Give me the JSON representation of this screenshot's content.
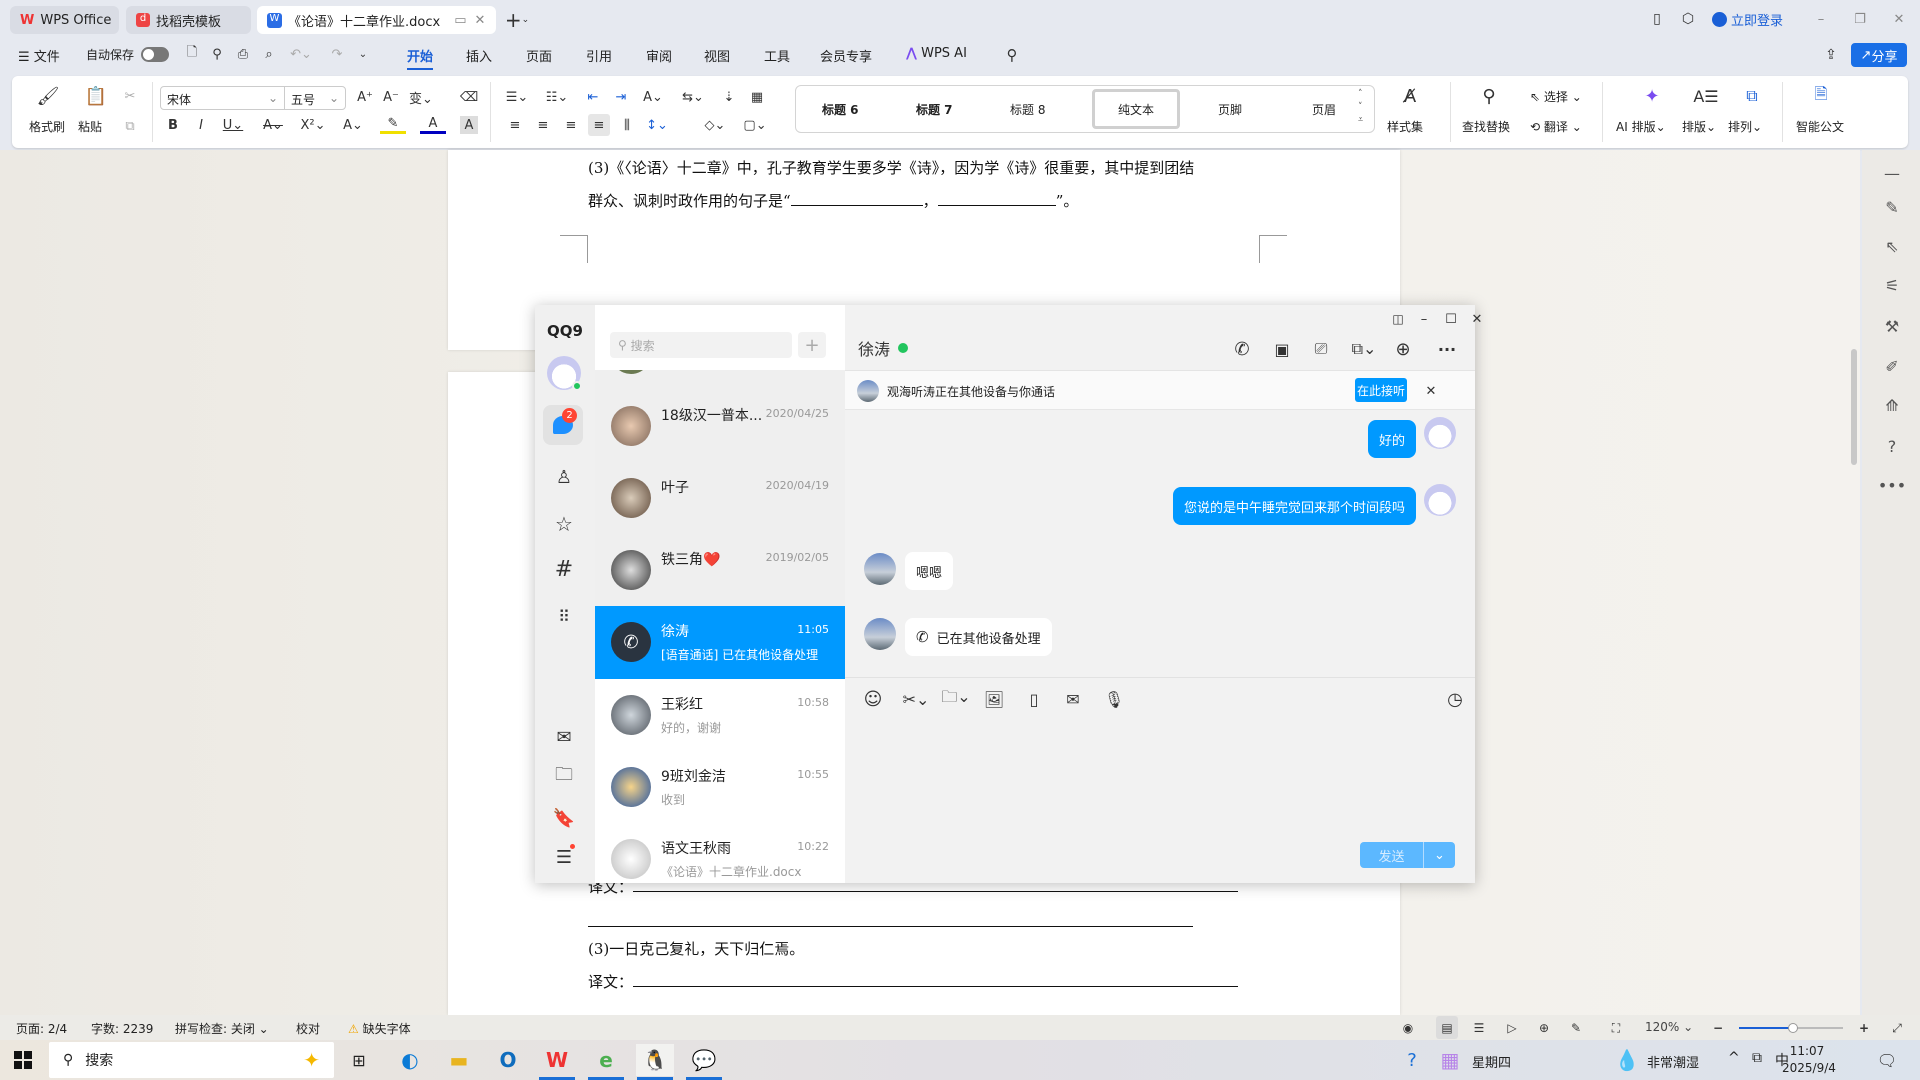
{
  "tabs": [
    {
      "label": "WPS Office"
    },
    {
      "label": "找稻壳模板"
    },
    {
      "label": "《论语》十二章作业.docx"
    }
  ],
  "titlebar": {
    "login": "立即登录"
  },
  "menu": {
    "file": "文件",
    "autosave": "自动保存",
    "items": [
      "开始",
      "插入",
      "页面",
      "引用",
      "审阅",
      "视图",
      "工具",
      "会员专享",
      "WPS AI"
    ],
    "active": "开始",
    "share": "分享"
  },
  "ribbon": {
    "format_painter": "格式刷",
    "paste": "粘贴",
    "font_name": "宋体",
    "font_size": "五号",
    "styles": [
      "标题 6",
      "标题 7",
      "标题 8",
      "纯文本",
      "页脚",
      "页眉"
    ],
    "selected_style": "纯文本",
    "style_set": "样式集",
    "find_replace": "查找替换",
    "select": "选择",
    "translate": "翻译",
    "ai_layout": "AI 排版",
    "layout": "排版",
    "arrange": "排列",
    "smart_doc": "智能公文"
  },
  "document": {
    "line1": "(3)《〈论语〉十二章》中，孔子教育学生要多学《诗》，因为学《诗》很重要，其中提到团结",
    "line2_prefix": "群众、讽刺时政作用的句子是“",
    "line2_sep": "，",
    "line2_suffix": "”。",
    "translation_label": "译文：",
    "item3": "(3)一日克己复礼，天下归仁焉。"
  },
  "qq": {
    "logo": "QQ9",
    "unread_badge": "2",
    "search_placeholder": "搜索",
    "conversations": [
      {
        "name": "18级汉一普本...",
        "time": "2020/04/25",
        "preview": ""
      },
      {
        "name": "叶子",
        "time": "2020/04/19",
        "preview": ""
      },
      {
        "name": "铁三角❤️",
        "time": "2019/02/05",
        "preview": ""
      },
      {
        "name": "徐涛",
        "time": "11:05",
        "preview": "[语音通话] 已在其他设备处理",
        "selected": true
      },
      {
        "name": "王彩红",
        "time": "10:58",
        "preview": "好的，谢谢"
      },
      {
        "name": "9班刘金洁",
        "time": "10:55",
        "preview": "收到"
      },
      {
        "name": "语文王秋雨",
        "time": "10:22",
        "preview": "《论语》十二章作业.docx"
      }
    ],
    "chat": {
      "title": "徐涛",
      "online_color": "#22c55e",
      "notice": "观海听涛正在其他设备与你通话",
      "notice_button": "在此接听",
      "messages": [
        {
          "from": "me",
          "text": "好的"
        },
        {
          "from": "me",
          "text": "您说的是中午睡完觉回来那个时间段吗"
        },
        {
          "from": "other",
          "text": "嗯嗯"
        },
        {
          "from": "other",
          "text": "已在其他设备处理",
          "icon": "phone-icon"
        }
      ],
      "send": "发送"
    },
    "accent": "#0099ff"
  },
  "status": {
    "page": "页面: 2/4",
    "words": "字数: 2239",
    "spell": "拼写检查: 关闭",
    "proof": "校对",
    "missing_font": "缺失字体",
    "zoom": "120%",
    "zoom_level": 120
  },
  "taskbar": {
    "search": "搜索",
    "weekday": "星期四",
    "weather": "非常潮湿",
    "ime": "中",
    "time": "11:07",
    "date": "2025/9/4"
  }
}
